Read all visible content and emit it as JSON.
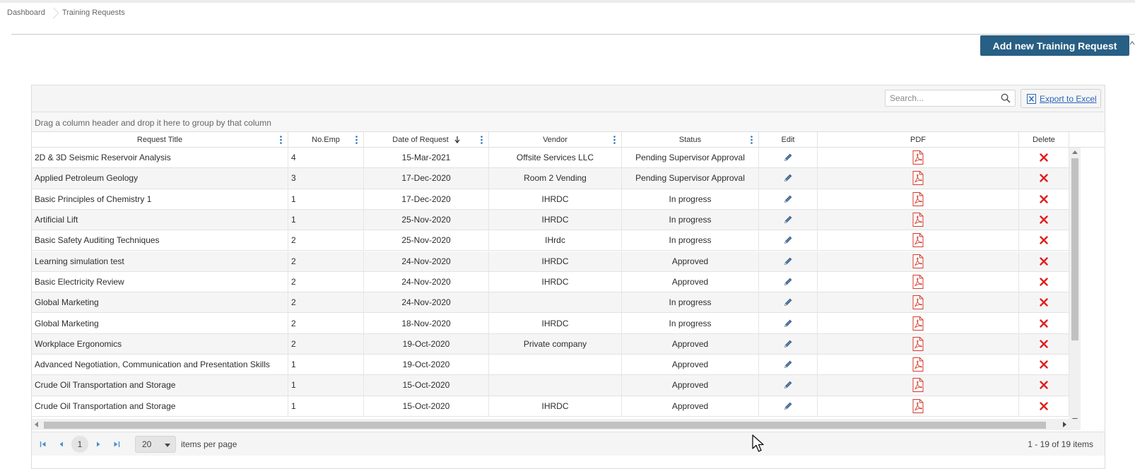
{
  "breadcrumb": {
    "items": [
      "Dashboard",
      "Training Requests"
    ]
  },
  "actions": {
    "add_label": "Add new Training Request"
  },
  "toolbar": {
    "search_placeholder": "Search...",
    "export_label": "Export to Excel"
  },
  "group_panel": {
    "hint": "Drag a column header and drop it here to group by that column"
  },
  "columns": [
    "Request Title",
    "No.Emp",
    "Date of Request",
    "Vendor",
    "Status",
    "Edit",
    "PDF",
    "Delete"
  ],
  "sort": {
    "column": "Date of Request",
    "direction": "descending"
  },
  "icons": {
    "edit": "pencil-icon",
    "pdf": "pdf-icon",
    "delete": "delete-x-icon",
    "search": "search-icon",
    "export": "excel-icon"
  },
  "colors": {
    "primary": "#285f84",
    "delete": "#e02020",
    "pdf": "#d33a2c",
    "link": "#2b65b8"
  },
  "rows": [
    {
      "title": "2D & 3D Seismic Reservoir Analysis",
      "emp": "4",
      "date": "15-Mar-2021",
      "vendor": "Offsite Services LLC",
      "status": "Pending Supervisor Approval"
    },
    {
      "title": "Applied Petroleum Geology",
      "emp": "3",
      "date": "17-Dec-2020",
      "vendor": "Room 2 Vending",
      "status": "Pending Supervisor Approval"
    },
    {
      "title": "Basic Principles of Chemistry 1",
      "emp": "1",
      "date": "17-Dec-2020",
      "vendor": "IHRDC",
      "status": "In progress"
    },
    {
      "title": "Artificial Lift",
      "emp": "1",
      "date": "25-Nov-2020",
      "vendor": "IHRDC",
      "status": "In progress"
    },
    {
      "title": "Basic Safety Auditing Techniques",
      "emp": "2",
      "date": "25-Nov-2020",
      "vendor": "IHrdc",
      "status": "In progress"
    },
    {
      "title": "Learning simulation test",
      "emp": "2",
      "date": "24-Nov-2020",
      "vendor": "IHRDC",
      "status": "Approved"
    },
    {
      "title": "Basic Electricity Review",
      "emp": "2",
      "date": "24-Nov-2020",
      "vendor": "IHRDC",
      "status": "Approved"
    },
    {
      "title": "Global Marketing",
      "emp": "2",
      "date": "24-Nov-2020",
      "vendor": "",
      "status": "In progress"
    },
    {
      "title": "Global Marketing",
      "emp": "2",
      "date": "18-Nov-2020",
      "vendor": "IHRDC",
      "status": "In progress"
    },
    {
      "title": "Workplace Ergonomics",
      "emp": "2",
      "date": "19-Oct-2020",
      "vendor": "Private company",
      "status": "Approved"
    },
    {
      "title": "Advanced Negotiation, Communication and Presentation Skills",
      "emp": "1",
      "date": "19-Oct-2020",
      "vendor": "",
      "status": "Approved"
    },
    {
      "title": "Crude Oil Transportation and Storage",
      "emp": "1",
      "date": "15-Oct-2020",
      "vendor": "",
      "status": "Approved"
    },
    {
      "title": "Crude Oil Transportation and Storage",
      "emp": "1",
      "date": "15-Oct-2020",
      "vendor": "IHRDC",
      "status": "Approved"
    }
  ],
  "pager": {
    "current_page": "1",
    "page_size": "20",
    "page_size_label": "items per page",
    "info": "1 - 19 of 19 items"
  }
}
